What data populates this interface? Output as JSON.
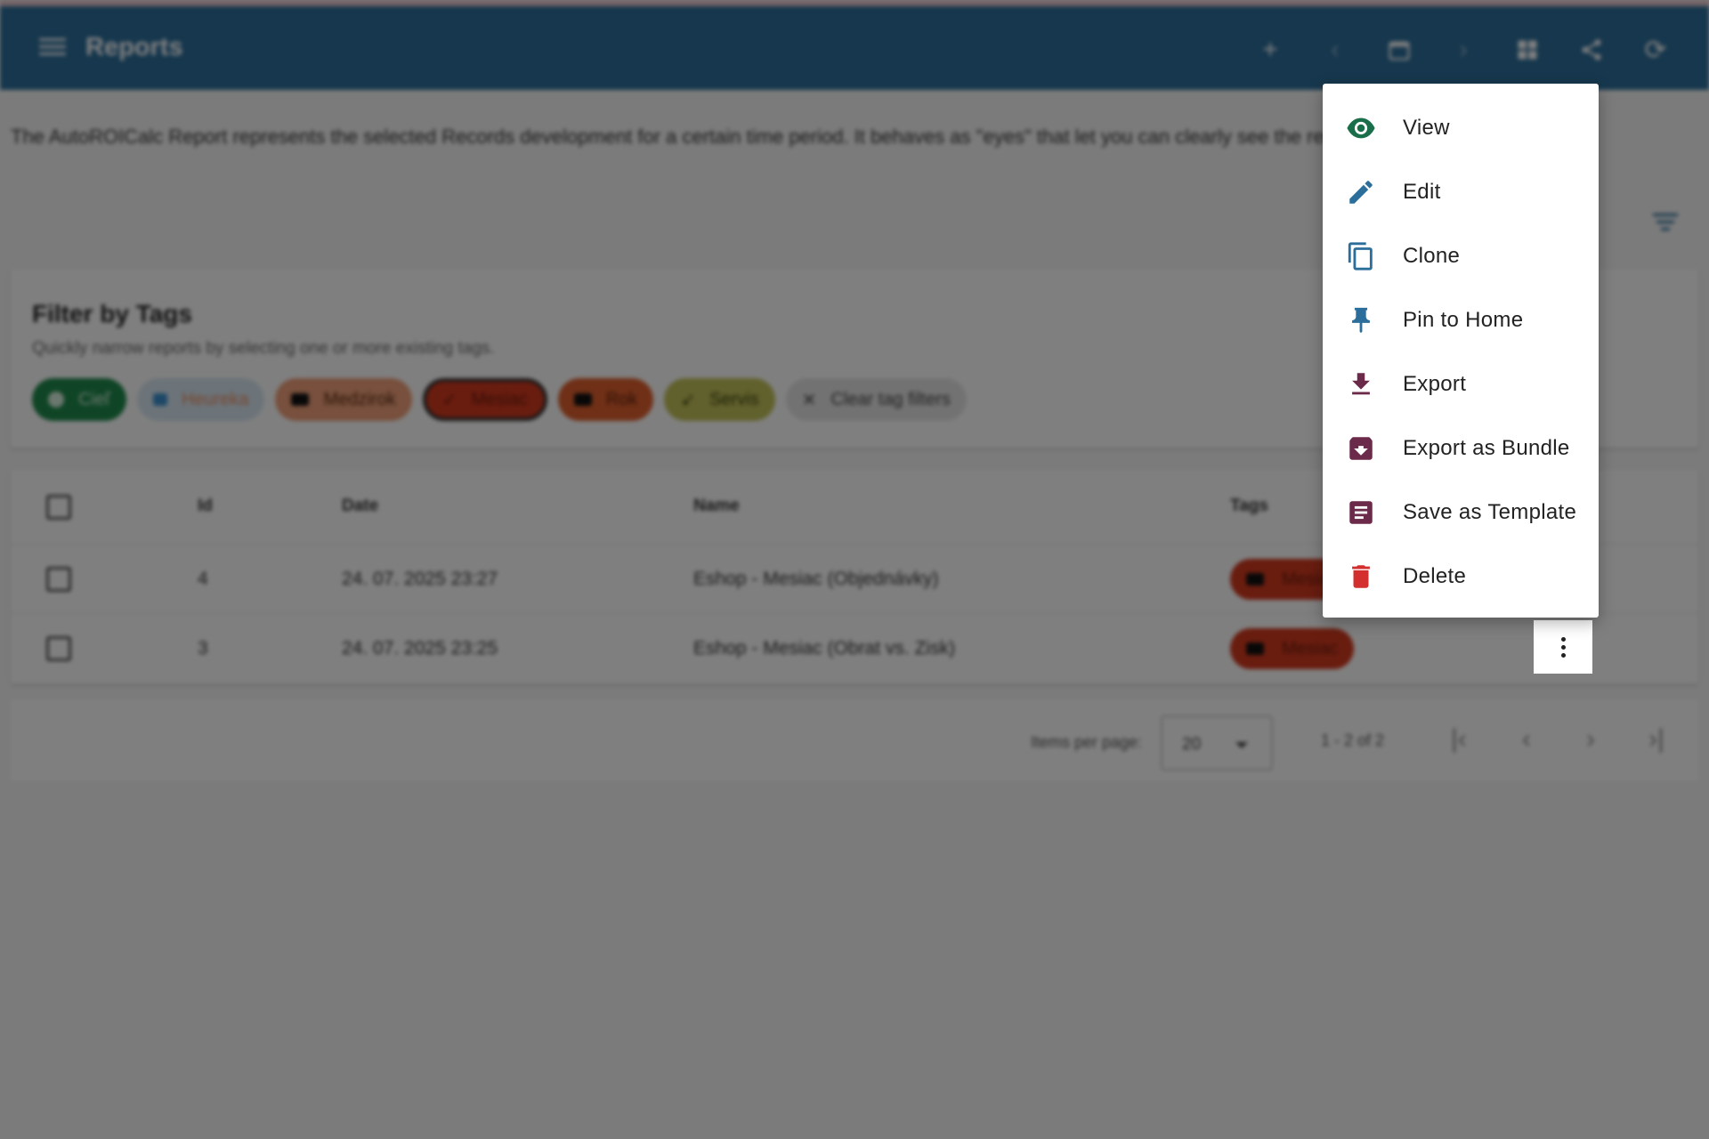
{
  "appbar": {
    "title": "Reports",
    "icons": [
      "menu-icon",
      "add-icon",
      "chevron-left-icon",
      "calendar-icon",
      "chevron-right-icon",
      "dashboard-icon",
      "share-icon",
      "refresh-icon"
    ]
  },
  "description": "The AutoROICalc Report represents the selected Records development for a certain time period. It behaves as \"eyes\" that let you can clearly see the results of your activities.",
  "filter": {
    "title": "Filter by Tags",
    "subtitle": "Quickly narrow reports by selecting one or more existing tags.",
    "chips": [
      {
        "label": "Cieľ",
        "bg": "#1f8a4c",
        "fg": "#d8f0de"
      },
      {
        "label": "Heureka",
        "bg": "#d8e8f3",
        "fg": "#f08a5d"
      },
      {
        "label": "Medzirok",
        "bg": "#f0a07a",
        "fg": "#5a2a12"
      },
      {
        "label": "Mesiac",
        "bg": "#d33a1f",
        "fg": "#6b1a0c"
      },
      {
        "label": "Rok",
        "bg": "#e0602e",
        "fg": "#5a220c"
      },
      {
        "label": "Servis",
        "bg": "#c2c25a",
        "fg": "#3e3e10"
      },
      {
        "label": "Clear tag filters",
        "bg": "#e5e5e5",
        "fg": "#444"
      }
    ]
  },
  "table": {
    "headers": {
      "id": "Id",
      "date": "Date",
      "name": "Name",
      "tags": "Tags"
    },
    "rows": [
      {
        "id": "4",
        "date": "24. 07. 2025 23:27",
        "name": "Eshop - Mesiac (Objednávky)",
        "tag": "Mesiac"
      },
      {
        "id": "3",
        "date": "24. 07. 2025 23:25",
        "name": "Eshop - Mesiac (Obrat vs. Zisk)",
        "tag": "Mesiac"
      }
    ]
  },
  "pager": {
    "items_per_page_label": "Items per page:",
    "items_per_page_value": "20",
    "range": "1 - 2 of 2"
  },
  "context_menu": {
    "items": [
      {
        "label": "View",
        "icon": "eye-icon",
        "color": "#1b6e4a"
      },
      {
        "label": "Edit",
        "icon": "pencil-icon",
        "color": "#2c6e9b"
      },
      {
        "label": "Clone",
        "icon": "copy-icon",
        "color": "#2c6e9b"
      },
      {
        "label": "Pin to Home",
        "icon": "pin-icon",
        "color": "#2c6e9b"
      },
      {
        "label": "Export",
        "icon": "download-icon",
        "color": "#6b2a4a"
      },
      {
        "label": "Export as Bundle",
        "icon": "archive-icon",
        "color": "#6b2a4a"
      },
      {
        "label": "Save as Template",
        "icon": "document-icon",
        "color": "#6b2a4a"
      },
      {
        "label": "Delete",
        "icon": "trash-icon",
        "color": "#d32f2f"
      }
    ]
  }
}
